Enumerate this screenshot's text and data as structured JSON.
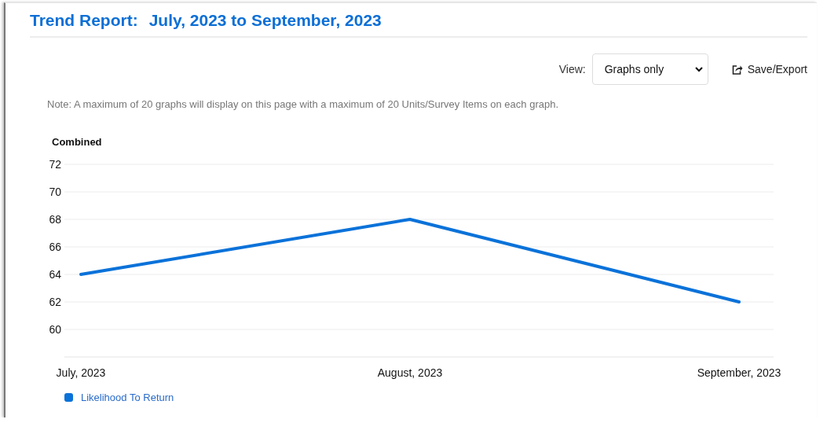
{
  "header": {
    "label": "Trend Report:",
    "period": "July, 2023 to September, 2023"
  },
  "toolbar": {
    "view_label": "View:",
    "view_value": "Graphs only",
    "save_export": "Save/Export"
  },
  "note": "Note: A maximum of 20 graphs will display on this page with a maximum of 20 Units/Survey Items on each graph.",
  "graph": {
    "title": "Combined",
    "chart_data": {
      "type": "line",
      "categories": [
        "July, 2023",
        "August, 2023",
        "September, 2023"
      ],
      "series": [
        {
          "name": "Likelihood To Return",
          "color": "#0b72d9",
          "values": [
            64,
            68,
            62
          ]
        }
      ],
      "ylim": [
        58,
        72
      ],
      "grid": true,
      "yticks": [
        60,
        62,
        64,
        66,
        68,
        70,
        72
      ]
    }
  }
}
